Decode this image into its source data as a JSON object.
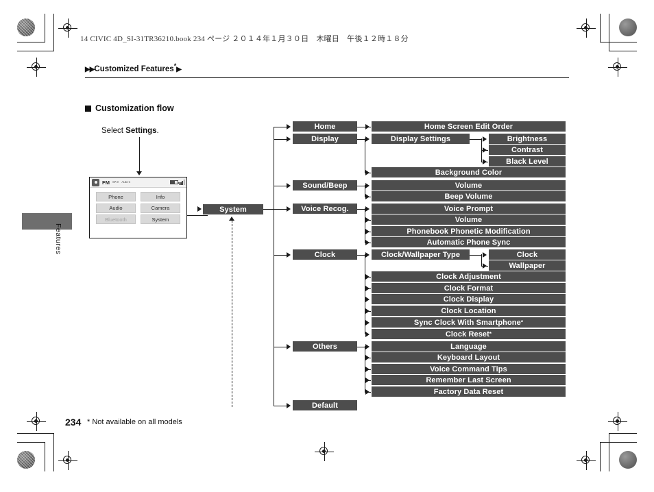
{
  "header": {
    "book_line": "14 CIVIC 4D_SI-31TR36210.book   234 ページ   ２０１４年１月３０日　木曜日　午後１２時１８分",
    "breadcrumb_text": "Customized Features",
    "breadcrumb_marker": "▶▶",
    "breadcrumb_marker_end": "▶",
    "breadcrumb_asterisk": "*"
  },
  "section": {
    "title": "Customization flow"
  },
  "sidebar": {
    "tab_label": "Features"
  },
  "caption": {
    "select_prefix": "Select ",
    "select_target": "Settings",
    "select_suffix": "."
  },
  "device": {
    "status": {
      "gear_icon": "gear-icon",
      "source": "FM",
      "preset_chip": "87.9",
      "track_chip": "Auto-s",
      "signal_icon": "signal-bars-icon",
      "battery_icon": "battery-icon"
    },
    "buttons": [
      {
        "label": "Phone",
        "dimmed": false
      },
      {
        "label": "Info",
        "dimmed": false
      },
      {
        "label": "Audio",
        "dimmed": false
      },
      {
        "label": "Camera",
        "dimmed": false
      },
      {
        "label": "Bluetooth",
        "dimmed": true
      },
      {
        "label": "System",
        "dimmed": false
      }
    ]
  },
  "flow": {
    "root": "System",
    "level1": {
      "home": "Home",
      "display": "Display",
      "sound_beep": "Sound/Beep",
      "voice_recog": "Voice Recog.",
      "clock": "Clock",
      "others": "Others",
      "default": "Default"
    },
    "level2": {
      "home_screen_edit_order": "Home Screen Edit Order",
      "display_settings": "Display Settings",
      "background_color": "Background Color",
      "volume": "Volume",
      "beep_volume": "Beep Volume",
      "voice_prompt": "Voice Prompt",
      "vr_volume": "Volume",
      "phonebook_phonetic_modification": "Phonebook Phonetic Modification",
      "automatic_phone_sync": "Automatic Phone Sync",
      "clock_wallpaper_type": "Clock/Wallpaper Type",
      "clock_adjustment": "Clock Adjustment",
      "clock_format": "Clock Format",
      "clock_display": "Clock Display",
      "clock_location": "Clock Location",
      "sync_clock_with_smartphone": "Sync Clock With Smartphone",
      "clock_reset": "Clock Reset",
      "language": "Language",
      "keyboard_layout": "Keyboard Layout",
      "voice_command_tips": "Voice Command Tips",
      "remember_last_screen": "Remember Last Screen",
      "factory_data_reset": "Factory Data Reset"
    },
    "level3": {
      "brightness": "Brightness",
      "contrast": "Contrast",
      "black_level": "Black Level",
      "clock": "Clock",
      "wallpaper": "Wallpaper"
    },
    "asterisk": "*"
  },
  "footer": {
    "page_number": "234",
    "footnote": "* Not available on all models"
  },
  "colors": {
    "node_fill": "#4d4d4d",
    "node_text": "#ffffff",
    "line": "#1a1a1a",
    "sidetab": "#6e6e6e"
  }
}
